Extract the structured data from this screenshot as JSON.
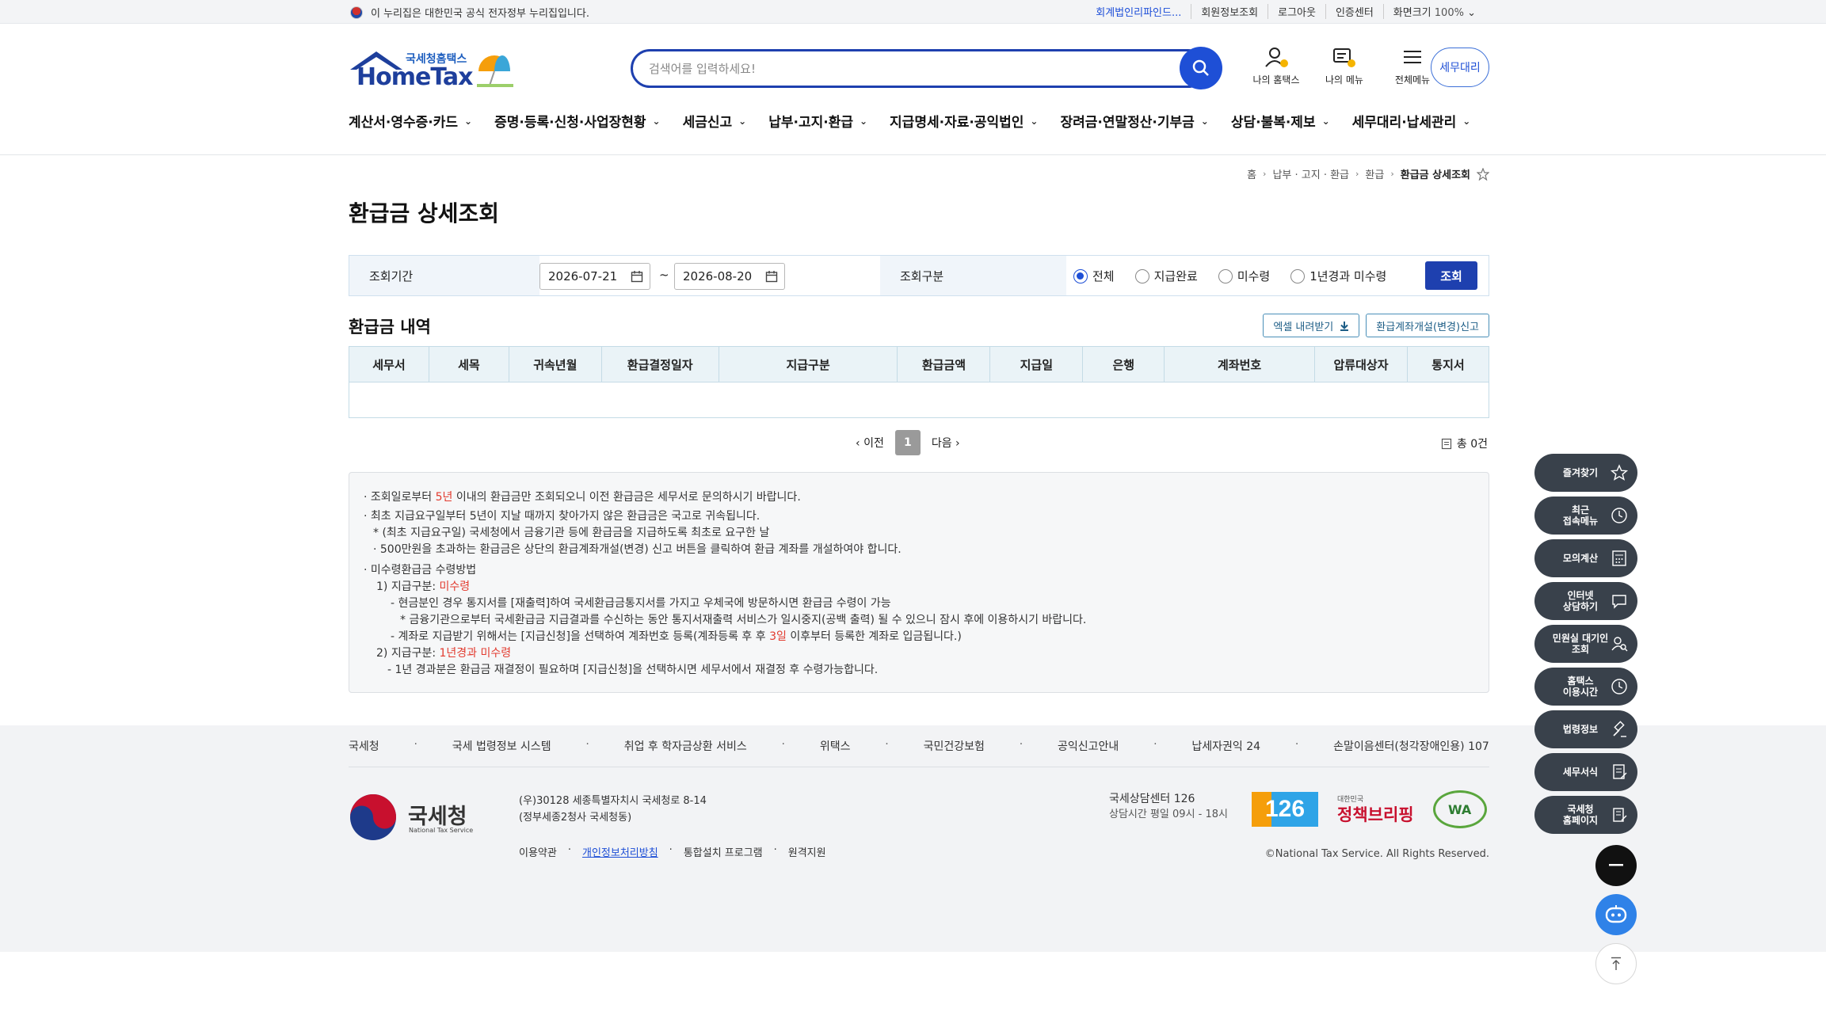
{
  "topbar": {
    "gov_notice": "이 누리집은 대한민국 공식 전자정부 누리집입니다.",
    "links": [
      "회계법인리파인드...",
      "회원정보조회",
      "로그아웃",
      "인증센터",
      "화면크기"
    ],
    "zoom": "100%"
  },
  "logo": {
    "sub": "국세청홈택스",
    "main": "HomeTax"
  },
  "search": {
    "placeholder": "검색어를 입력하세요!"
  },
  "header_icons": [
    "나의 홈택스",
    "나의 메뉴",
    "전체메뉴"
  ],
  "tax_agent_button": "세무대리",
  "gnb": [
    "계산서·영수증·카드",
    "증명·등록·신청·사업장현황",
    "세금신고",
    "납부·고지·환급",
    "지급명세·자료·공익법인",
    "장려금·연말정산·기부금",
    "상담·불복·제보",
    "세무대리·납세관리"
  ],
  "breadcrumb": [
    "홈",
    "납부 · 고지 · 환급",
    "환급",
    "환급금 상세조회"
  ],
  "page_title": "환급금 상세조회",
  "condition": {
    "period_label": "조회기간",
    "start_date": "2026-07-21",
    "end_date": "2026-08-20",
    "tilde": "~",
    "type_label": "조회구분",
    "options": [
      "전체",
      "지급완료",
      "미수령",
      "1년경과 미수령"
    ],
    "selected": "전체",
    "search_button": "조회"
  },
  "section_title": "환급금 내역",
  "actions": {
    "excel": "엑셀 내려받기",
    "account": "환급계좌개설(변경)신고"
  },
  "table": {
    "columns": [
      "세무서",
      "세목",
      "귀속년월",
      "환급결정일자",
      "지급구분",
      "환급금액",
      "지급일",
      "은행",
      "계좌번호",
      "압류대상자",
      "통지서"
    ],
    "rows": []
  },
  "pagination": {
    "prev": "이전",
    "current": "1",
    "next": "다음",
    "total": "총 0건"
  },
  "notice": {
    "l1a": "조회일로부터 ",
    "l1b": "5년",
    "l1c": " 이내의 환급금만 조회되오니 이전 환급금은 세무서로 문의하시기 바랍니다.",
    "l2": "최초 지급요구일부터 5년이 지날 때까지 찾아가지 않은 환급금은 국고로 귀속됩니다.",
    "l3": "* (최초 지급요구일) 국세청에서 금융기관 등에 환급금을 지급하도록 최초로 요구한 날",
    "l4": "· 500만원을 초과하는 환급금은 상단의 환급계좌개설(변경) 신고 버튼을 클릭하여 환급 계좌를 개설하여야 합니다.",
    "l5": "미수령환급금 수령방법",
    "l6a": "1) 지급구분: ",
    "l6b": "미수령",
    "l7": "- 현금분인 경우 통지서를 [재출력]하여 국세환급금통지서를 가지고 우체국에 방문하시면 환급금 수령이 가능",
    "l8": "* 금융기관으로부터 국세환급금 지급결과를 수신하는 동안 통지서재출력 서비스가 일시중지(공백 출력) 될 수 있으니 잠시 후에 이용하시기 바랍니다.",
    "l9a": "- 계좌로 지급받기 위해서는 [지급신청]을 선택하여 계좌번호 등록(계좌등록 후 후 ",
    "l9b": "3일",
    "l9c": " 이후부터 등록한 계좌로 입금됩니다.)",
    "l10a": "2) 지급구분: ",
    "l10b": "1년경과 미수령",
    "l11": "- 1년 경과분은 환급금 재결정이 필요하며 [지급신청]을 선택하시면 세무서에서 재결정 후 수령가능합니다."
  },
  "footer": {
    "links": [
      "국세청",
      "국세 법령정보 시스템",
      "취업 후 학자금상환 서비스",
      "위택스",
      "국민건강보험",
      "공익신고안내",
      "납세자권익 24",
      "손말이음센터(청각장애인용) 107"
    ],
    "org_name": "국세청",
    "org_en": "National Tax Service",
    "address1": "(우)30128 세종특별자치시 국세청로 8-14",
    "address2": "(정부세종2청사 국세청동)",
    "menu": [
      "이용약관",
      "개인정보처리방침",
      "통합설치 프로그램",
      "원격지원"
    ],
    "call_center": "국세상담센터 126",
    "hours": "상담시간 평일 09시 - 18시",
    "logo_126": "126",
    "policy_small": "대한민국",
    "policy_main": "정책브리핑",
    "wa": "WA",
    "copyright": "©National Tax Service. All Rights Reserved."
  },
  "quick_menu": [
    "즐겨찾기",
    "최근\n접속메뉴",
    "모의계산",
    "인터넷\n상담하기",
    "민원실 대기인\n조회",
    "홈택스\n이용시간",
    "법령정보",
    "세무서식",
    "국세청\n홈페이지"
  ],
  "colors": {
    "primary": "#1e40af",
    "accent_red": "#e23b2f",
    "quick_bg": "#39414b"
  }
}
